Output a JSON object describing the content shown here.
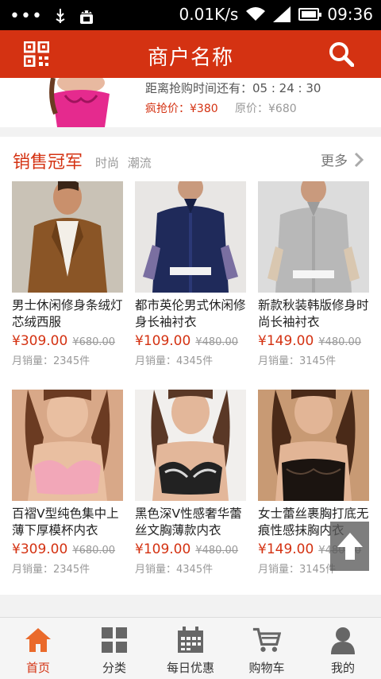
{
  "status_bar": {
    "network_speed": "0.01K/s",
    "time": "09:36",
    "left_icons": [
      "notification-dots",
      "usb-icon",
      "android-debug-icon"
    ],
    "right_icons": [
      "wifi-icon",
      "signal-icon",
      "battery-icon"
    ]
  },
  "header": {
    "title": "商户名称",
    "left_icon": "qr-code-icon",
    "right_icon": "search-icon",
    "color": "#d43212"
  },
  "flash_sale": {
    "countdown": "距离抢购时间还有：05 : 24 : 30",
    "sale_price": "疯抢价：¥380",
    "original_price": "原价：¥680"
  },
  "section": {
    "title": "销售冠军",
    "tags": "时尚  潮流",
    "more_label": "更多"
  },
  "products": [
    {
      "name": "男士休闲修身条绒灯芯绒西服",
      "price": "¥309.00",
      "old_price": "¥680.00",
      "sold": "月销量：2345件",
      "image": "brown-corduroy-blazer"
    },
    {
      "name": "都市英伦男式休闲修身长袖衬衣",
      "price": "¥109.00",
      "old_price": "¥480.00",
      "sold": "月销量：4345件",
      "image": "navy-shirt"
    },
    {
      "name": "新款秋装韩版修身时尚长袖衬衣",
      "price": "¥149.00",
      "old_price": "¥480.00",
      "sold": "月销量：3145件",
      "image": "grey-shirt"
    },
    {
      "name": "百褶V型纯色集中上薄下厚模杯内衣",
      "price": "¥309.00",
      "old_price": "¥680.00",
      "sold": "月销量：2345件",
      "image": "pink-bra"
    },
    {
      "name": "黑色深V性感奢华蕾丝文胸薄款内衣",
      "price": "¥109.00",
      "old_price": "¥480.00",
      "sold": "月销量：4345件",
      "image": "black-lace-bra"
    },
    {
      "name": "女士蕾丝裹胸打底无痕性感抹胸内衣",
      "price": "¥149.00",
      "old_price": "¥480.00",
      "sold": "月销量：3145件",
      "image": "black-lace-bandeau"
    }
  ],
  "tabs": [
    {
      "label": "首页",
      "icon": "home-icon",
      "active": true
    },
    {
      "label": "分类",
      "icon": "grid-icon",
      "active": false
    },
    {
      "label": "每日优惠",
      "icon": "calendar-icon",
      "active": false
    },
    {
      "label": "购物车",
      "icon": "cart-icon",
      "active": false
    },
    {
      "label": "我的",
      "icon": "user-icon",
      "active": false
    }
  ],
  "colors": {
    "accent": "#d43212",
    "price": "#d43212",
    "muted": "#999999"
  }
}
